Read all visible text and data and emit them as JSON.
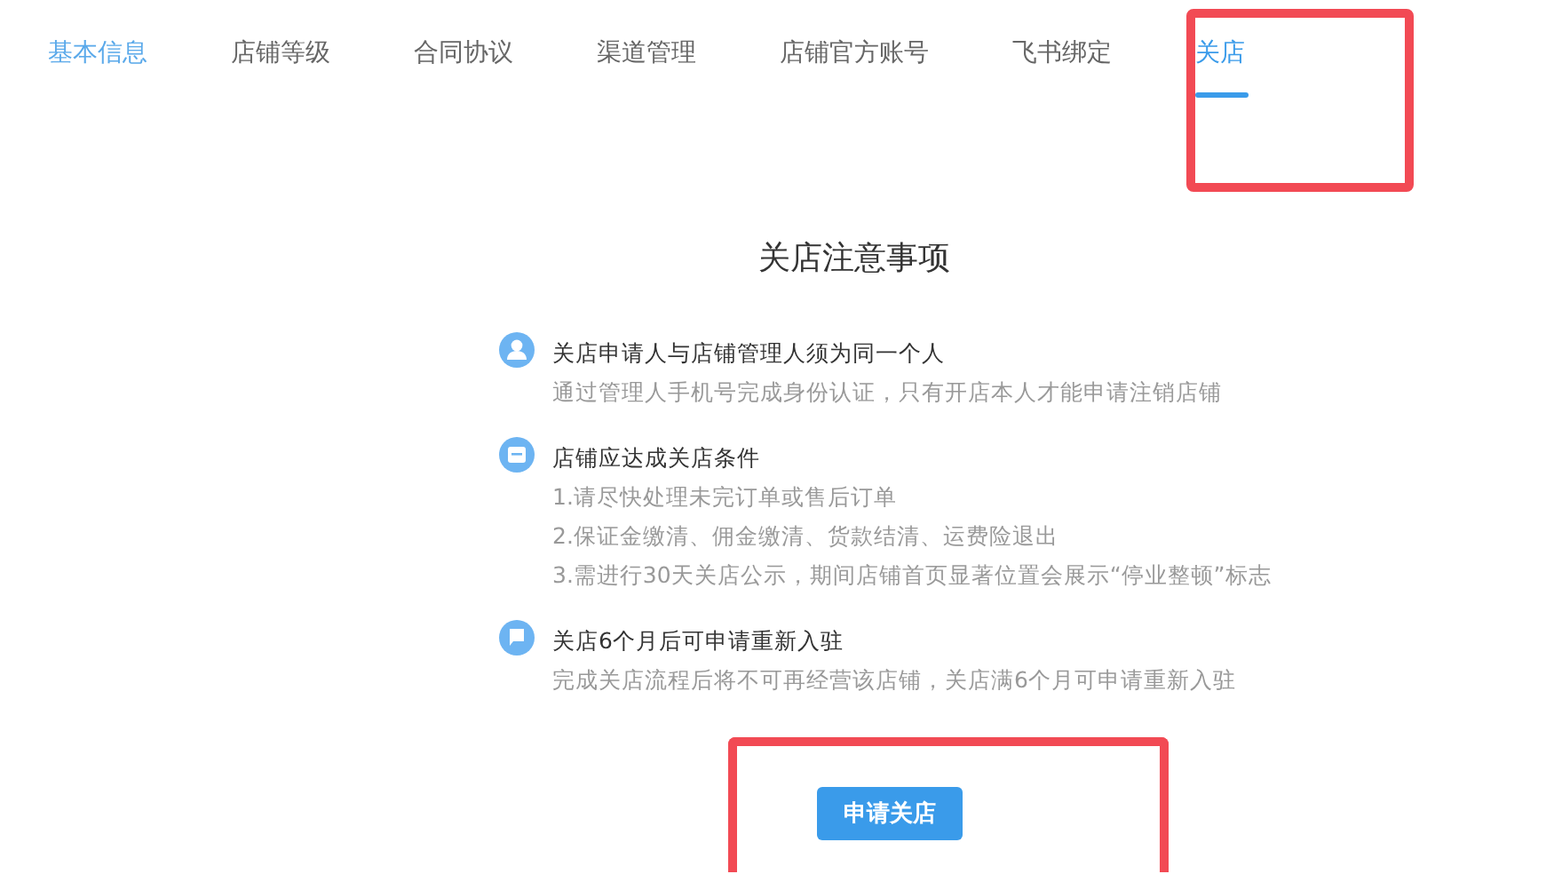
{
  "tabs": [
    {
      "label": "基本信息",
      "selected": false,
      "hovered": true,
      "highlighted": false
    },
    {
      "label": "店铺等级",
      "selected": false,
      "hovered": false,
      "highlighted": false
    },
    {
      "label": "合同协议",
      "selected": false,
      "hovered": false,
      "highlighted": false
    },
    {
      "label": "渠道管理",
      "selected": false,
      "hovered": false,
      "highlighted": false
    },
    {
      "label": "店铺官方账号",
      "selected": false,
      "hovered": false,
      "highlighted": false
    },
    {
      "label": "飞书绑定",
      "selected": false,
      "hovered": false,
      "highlighted": false
    },
    {
      "label": "关店",
      "selected": true,
      "hovered": false,
      "highlighted": true
    }
  ],
  "title": "关店注意事项",
  "notices": [
    {
      "kind": "person",
      "heading": "关店申请人与店铺管理人须为同一个人",
      "lines": [
        "通过管理人手机号完成身份认证，只有开店本人才能申请注销店铺"
      ]
    },
    {
      "kind": "store",
      "heading": "店铺应达成关店条件",
      "lines": [
        "1.请尽快处理未完订单或售后订单",
        "2.保证金缴清、佣金缴清、货款结清、运费险退出",
        "3.需进行30天关店公示，期间店铺首页显著位置会展示“停业整顿”标志"
      ]
    },
    {
      "kind": "flag",
      "heading": "关店6个月后可申请重新入驻",
      "lines": [
        "完成关店流程后将不可再经营该店铺，关店满6个月可申请重新入驻"
      ]
    }
  ],
  "close_button": {
    "label": "申请关店",
    "highlighted": true
  }
}
